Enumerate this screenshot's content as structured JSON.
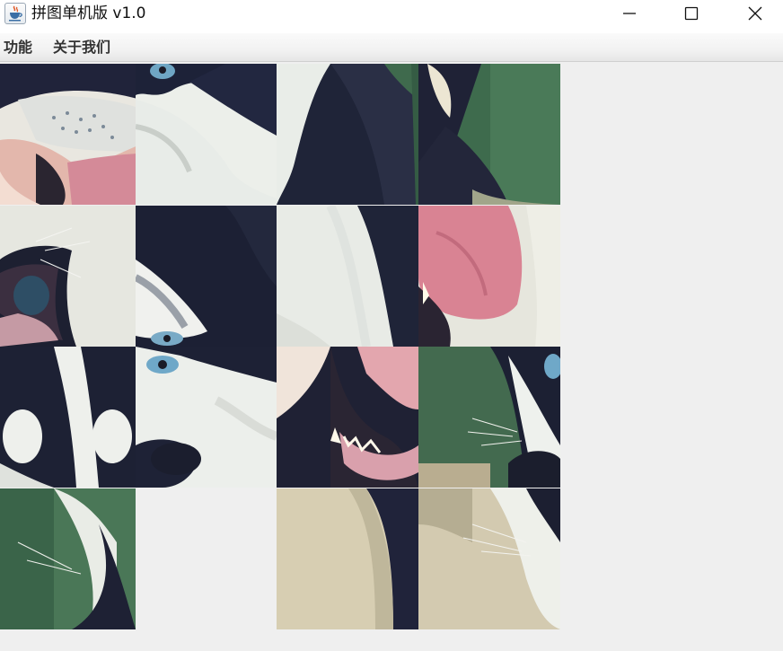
{
  "window": {
    "title": "拼图单机版 v1.0",
    "app_icon": "java-cup-icon",
    "controls": [
      "minimize-icon",
      "maximize-icon",
      "close-icon"
    ]
  },
  "menu": {
    "items": [
      {
        "label": "功能"
      },
      {
        "label": "关于我们"
      }
    ]
  },
  "puzzle": {
    "grid_size": 4,
    "tiles": [
      {
        "label": "muzzle-nose-tongue-corner"
      },
      {
        "label": "blue-eye-white-fur"
      },
      {
        "label": "dark-fur-cheek"
      },
      {
        "label": "ear-green-background"
      },
      {
        "label": "mouth-open-edge"
      },
      {
        "label": "dark-fur-whiskers"
      },
      {
        "label": "white-fur-shoulder"
      },
      {
        "label": "pink-tongue"
      },
      {
        "label": "forehead-markings"
      },
      {
        "label": "eye-and-nose"
      },
      {
        "label": "open-mouth-teeth"
      },
      {
        "label": "eye-nose-whiskers"
      },
      {
        "label": "green-blur-whiskers"
      },
      {
        "label": "empty"
      },
      {
        "label": "fur-beige-blur"
      },
      {
        "label": "white-chest-beige"
      }
    ],
    "empty_slot": 13
  },
  "colors": {
    "window_bg": "#efefef",
    "fur_dark": "#1e2337",
    "fur_white": "#eef0ea",
    "tongue_pink": "#d57d8e",
    "eye_blue": "#6fa8c8",
    "bg_green": "#3d6a4c",
    "bg_beige": "#d9cfb4"
  }
}
